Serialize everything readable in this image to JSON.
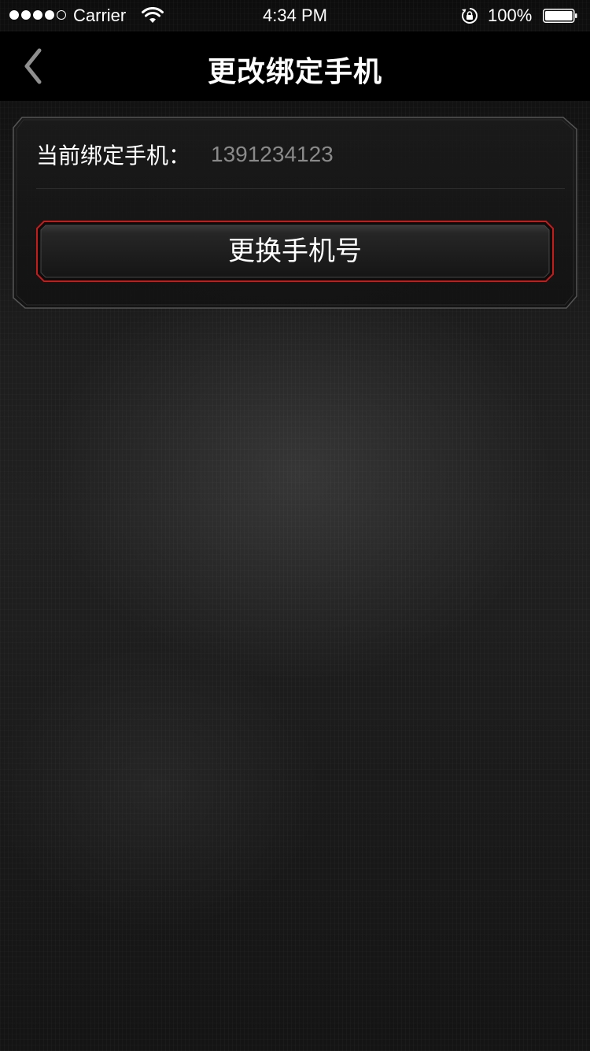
{
  "status_bar": {
    "carrier": "Carrier",
    "time": "4:34 PM",
    "battery_percent": "100%",
    "signal_bars_filled": 4,
    "signal_bars_total": 5
  },
  "nav": {
    "title": "更改绑定手机",
    "back_icon": "chevron-left-icon"
  },
  "binding": {
    "label": "当前绑定手机：",
    "phone": "1391234123"
  },
  "actions": {
    "change_phone_label": "更换手机号"
  },
  "colors": {
    "accent_red": "#c41b1b",
    "background": "#1a1a1a",
    "value_gray": "#8a8a8a"
  }
}
